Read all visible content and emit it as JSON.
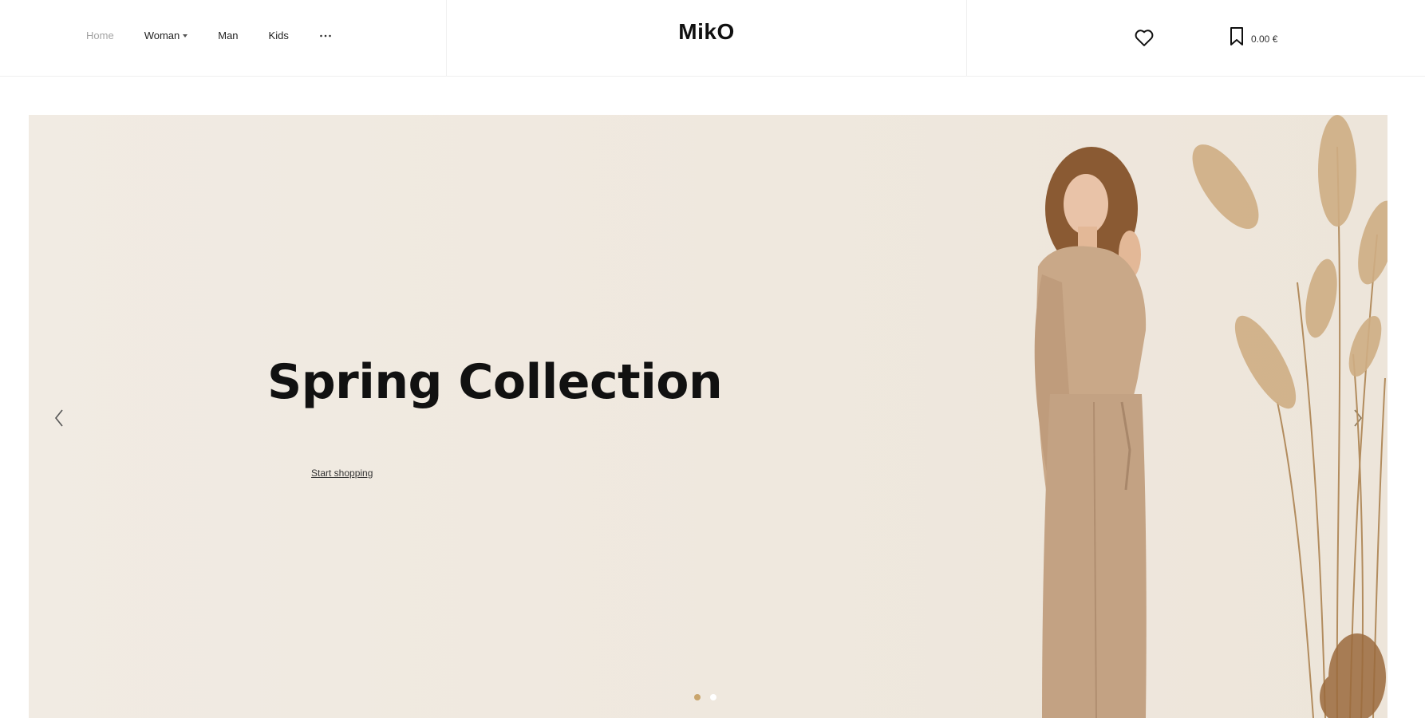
{
  "header": {
    "nav": {
      "items": [
        {
          "label": "Home",
          "active": true,
          "has_dropdown": false
        },
        {
          "label": "Woman",
          "active": false,
          "has_dropdown": true
        },
        {
          "label": "Man",
          "active": false,
          "has_dropdown": false
        },
        {
          "label": "Kids",
          "active": false,
          "has_dropdown": false
        }
      ],
      "more_icon": "more-horizontal-icon"
    },
    "logo": "MikO",
    "wishlist_icon": "heart-icon",
    "cart": {
      "icon": "bookmark-bag-icon",
      "total": "0.00 €"
    }
  },
  "hero": {
    "title": "Spring Collection",
    "cta_label": "Start shopping",
    "prev_icon": "chevron-left-icon",
    "next_icon": "chevron-right-icon",
    "slides_count": 2,
    "active_slide": 1
  },
  "colors": {
    "hero_background": "#f0e9e0",
    "accent": "#c9a56d",
    "text": "#111111",
    "nav_active": "#a3a3a3"
  }
}
